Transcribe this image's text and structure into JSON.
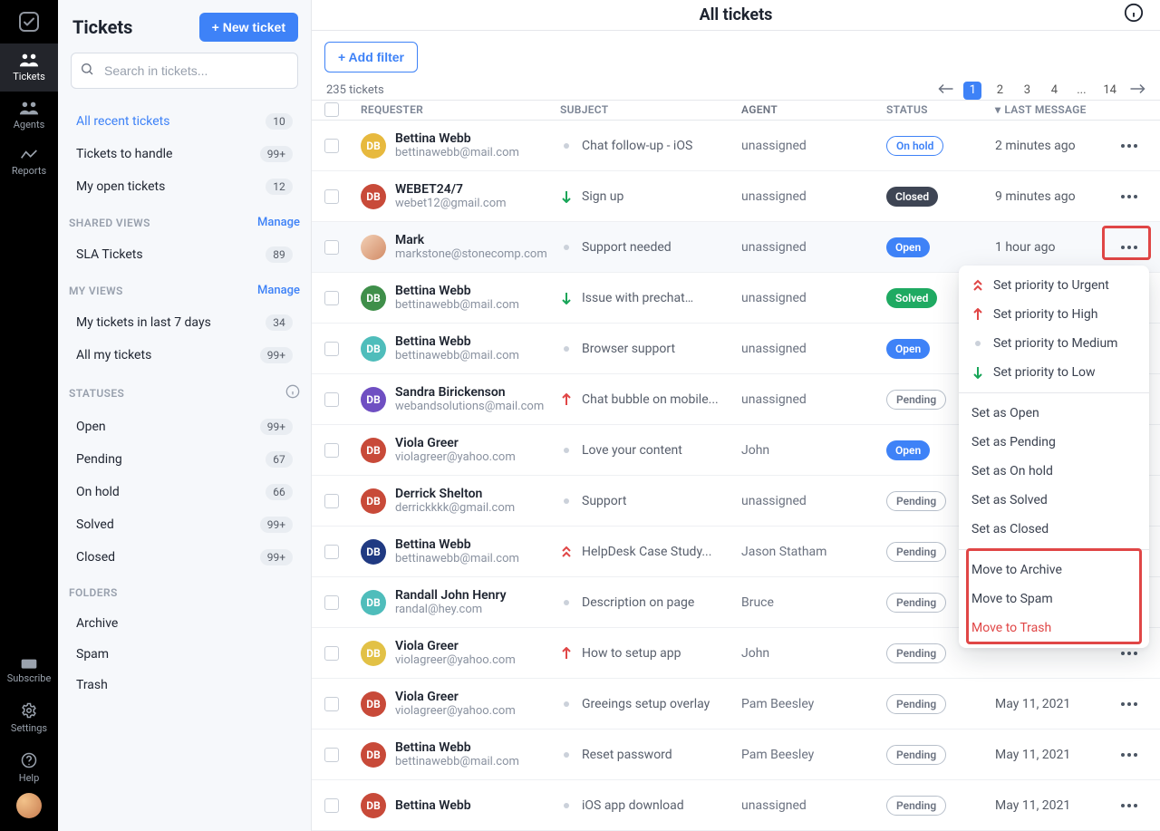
{
  "rail": {
    "items": [
      {
        "key": "tickets",
        "label": "Tickets"
      },
      {
        "key": "agents",
        "label": "Agents"
      },
      {
        "key": "reports",
        "label": "Reports"
      }
    ],
    "bottom": [
      {
        "key": "subscribe",
        "label": "Subscribe"
      },
      {
        "key": "settings",
        "label": "Settings"
      },
      {
        "key": "help",
        "label": "Help"
      }
    ]
  },
  "sidebar": {
    "title": "Tickets",
    "new_ticket": "+ New ticket",
    "search_placeholder": "Search in tickets...",
    "groups": {
      "recent": [
        {
          "label": "All recent tickets",
          "count": "10",
          "active": true
        },
        {
          "label": "Tickets to handle",
          "count": "99+"
        },
        {
          "label": "My open tickets",
          "count": "12"
        }
      ],
      "shared_label": "SHARED VIEWS",
      "manage": "Manage",
      "shared": [
        {
          "label": "SLA Tickets",
          "count": "89"
        }
      ],
      "myviews_label": "MY VIEWS",
      "myviews_manage": "Manage",
      "myviews": [
        {
          "label": "My tickets in last 7 days",
          "count": "34"
        },
        {
          "label": "All my tickets",
          "count": "99+"
        }
      ],
      "statuses_label": "STATUSES",
      "statuses": [
        {
          "label": "Open",
          "count": "99+"
        },
        {
          "label": "Pending",
          "count": "67"
        },
        {
          "label": "On hold",
          "count": "66"
        },
        {
          "label": "Solved",
          "count": "99+"
        },
        {
          "label": "Closed",
          "count": "99+"
        }
      ],
      "folders_label": "FOLDERS",
      "folders": [
        {
          "label": "Archive"
        },
        {
          "label": "Spam"
        },
        {
          "label": "Trash"
        }
      ]
    }
  },
  "header": {
    "title": "All tickets"
  },
  "toolbar": {
    "add_filter": "+ Add filter",
    "count": "235 tickets"
  },
  "pager": {
    "pages": [
      "1",
      "2",
      "3",
      "4",
      "...",
      "14"
    ],
    "active_index": 0
  },
  "columns": {
    "requester": "REQUESTER",
    "subject": "SUBJECT",
    "agent": "AGENT",
    "status": "STATUS",
    "last": "LAST MESSAGE"
  },
  "rows": [
    {
      "avatar": "DB",
      "avColor": "#e7b93e",
      "name": "Bettina Webb",
      "email": "bettinawebb@mail.com",
      "priority": "dot",
      "subject": "Chat follow-up - iOS",
      "agent": "unassigned",
      "status": "On hold",
      "statusKind": "onhold",
      "time": "2 minutes ago"
    },
    {
      "avatar": "DB",
      "avColor": "#c84a39",
      "name": "WEBET24/7",
      "email": "webet12@gmail.com",
      "priority": "down",
      "subject": "Sign up",
      "agent": "unassigned",
      "status": "Closed",
      "statusKind": "closed",
      "time": "9 minutes ago"
    },
    {
      "avatar": "IMG",
      "avColor": "#8aaef3",
      "name": "Mark",
      "email": "markstone@stonecomp.com",
      "priority": "dot",
      "subject": "Support needed",
      "agent": "unassigned",
      "status": "Open",
      "statusKind": "open",
      "time": "1 hour ago",
      "rowActive": true
    },
    {
      "avatar": "DB",
      "avColor": "#3f8f4a",
      "name": "Bettina Webb",
      "email": "bettinawebb@mail.com",
      "priority": "down",
      "subject": "Issue with prechat…",
      "agent": "unassigned",
      "status": "Solved",
      "statusKind": "solved",
      "time": ""
    },
    {
      "avatar": "DB",
      "avColor": "#4fbdbb",
      "name": "Bettina Webb",
      "email": "bettinawebb@mail.com",
      "priority": "dot",
      "subject": "Browser support",
      "agent": "unassigned",
      "status": "Open",
      "statusKind": "open",
      "time": ""
    },
    {
      "avatar": "DB",
      "avColor": "#6f4fc2",
      "name": "Sandra Birickenson",
      "email": "webandsolutions@mail.com",
      "priority": "up",
      "subject": "Chat bubble on mobile...",
      "agent": "unassigned",
      "status": "Pending",
      "statusKind": "pending",
      "time": ""
    },
    {
      "avatar": "DB",
      "avColor": "#c84a39",
      "name": "Viola Greer",
      "email": "violagreer@yahoo.com",
      "priority": "dot",
      "subject": "Love your content",
      "agent": "John",
      "status": "Open",
      "statusKind": "open",
      "time": ""
    },
    {
      "avatar": "DB",
      "avColor": "#c84a39",
      "name": "Derrick Shelton",
      "email": "derrickkkk@gmail.com",
      "priority": "dot",
      "subject": "Support",
      "agent": "unassigned",
      "status": "Pending",
      "statusKind": "pending",
      "time": ""
    },
    {
      "avatar": "DB",
      "avColor": "#203a82",
      "name": "Bettina Webb",
      "email": "bettinawebb@mail.com",
      "priority": "dup",
      "subject": "HelpDesk Case Study...",
      "agent": "Jason Statham",
      "status": "Pending",
      "statusKind": "pending",
      "time": ""
    },
    {
      "avatar": "DB",
      "avColor": "#4fbdbb",
      "name": "Randall John Henry",
      "email": "randal@hey.com",
      "priority": "dot",
      "subject": "Description on page",
      "agent": "Bruce",
      "status": "Pending",
      "statusKind": "pending",
      "time": ""
    },
    {
      "avatar": "DB",
      "avColor": "#e2c146",
      "name": "Viola Greer",
      "email": "violagreer@yahoo.com",
      "priority": "up",
      "subject": "How to setup app",
      "agent": "John",
      "status": "Pending",
      "statusKind": "pending",
      "time": ""
    },
    {
      "avatar": "DB",
      "avColor": "#c84a39",
      "name": "Viola Greer",
      "email": "violagreer@yahoo.com",
      "priority": "dot",
      "subject": "Greeings setup overlay",
      "agent": "Pam Beesley",
      "status": "Pending",
      "statusKind": "pending",
      "time": "May 11, 2021"
    },
    {
      "avatar": "DB",
      "avColor": "#c84a39",
      "name": "Bettina Webb",
      "email": "bettinawebb@mail.com",
      "priority": "dot",
      "subject": "Reset password",
      "agent": "Pam Beesley",
      "status": "Pending",
      "statusKind": "pending",
      "time": "May 11, 2021"
    },
    {
      "avatar": "DB",
      "avColor": "#c84a39",
      "name": "Bettina Webb",
      "email": "",
      "priority": "dot",
      "subject": "iOS app download",
      "agent": "unassigned",
      "status": "Pending",
      "statusKind": "pending",
      "time": "May 11, 2021"
    }
  ],
  "menu": {
    "pri_urgent": "Set priority to Urgent",
    "pri_high": "Set priority to High",
    "pri_medium": "Set priority to Medium",
    "pri_low": "Set priority to Low",
    "open": "Set as Open",
    "pending": "Set as Pending",
    "onhold": "Set as On hold",
    "solved": "Set as Solved",
    "closed": "Set as Closed",
    "archive": "Move to Archive",
    "spam": "Move to Spam",
    "trash": "Move to Trash"
  }
}
